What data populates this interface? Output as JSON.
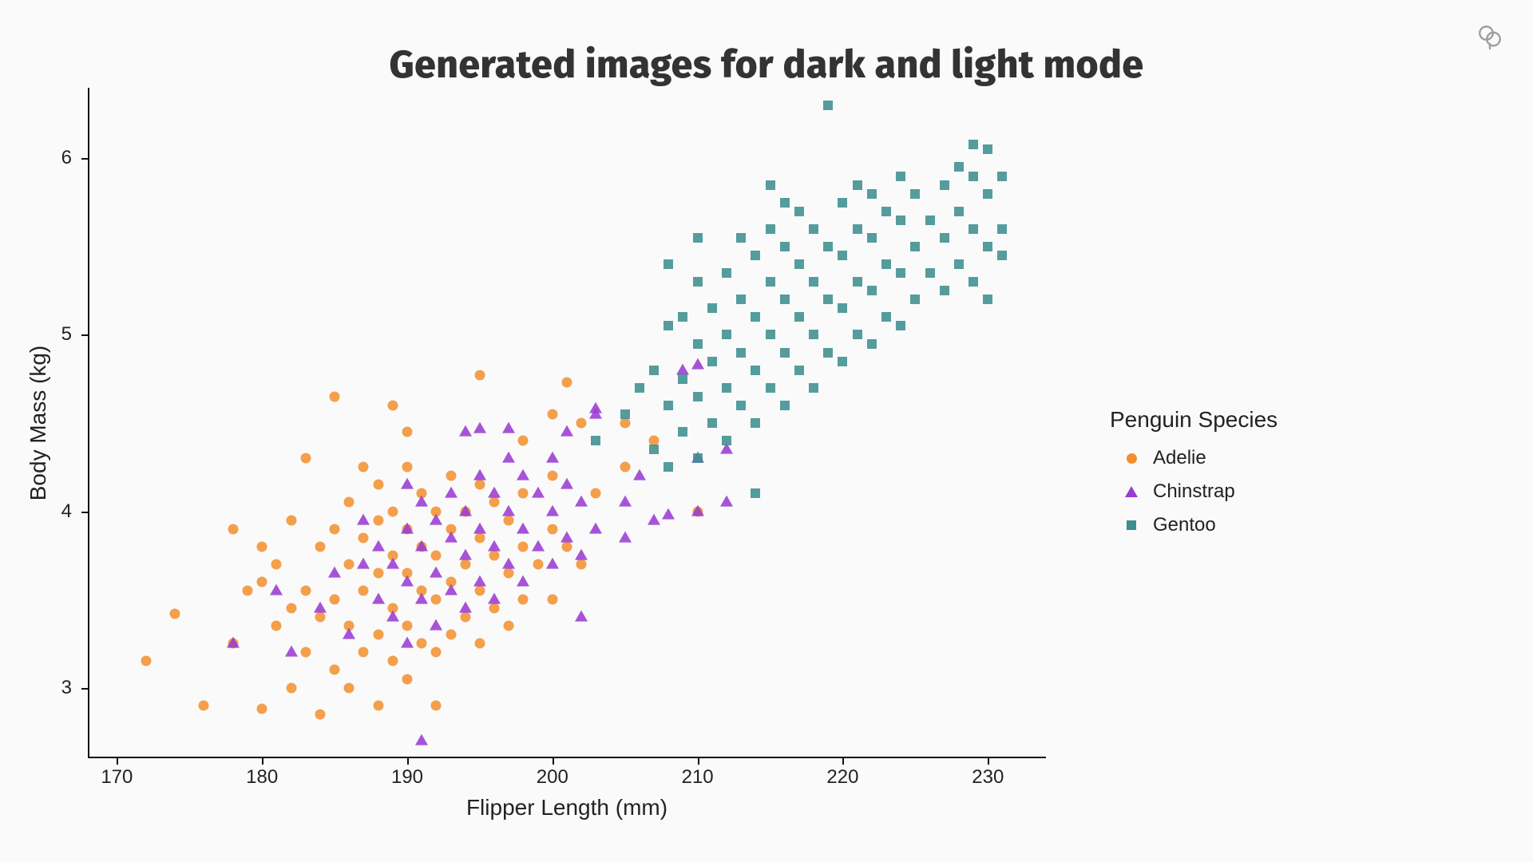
{
  "title": "Generated images for dark and light mode",
  "theme_toggle_name": "theme-toggle",
  "legend": {
    "title": "Penguin Species",
    "items": [
      {
        "label": "Adelie",
        "shape": "circle",
        "color": "#f28e2b"
      },
      {
        "label": "Chinstrap",
        "shape": "triangle",
        "color": "#9b3bd1"
      },
      {
        "label": "Gentoo",
        "shape": "square",
        "color": "#3d8e8e"
      }
    ]
  },
  "chart_data": {
    "type": "scatter",
    "title": "Generated images for dark and light mode",
    "xlabel": "Flipper Length (mm)",
    "ylabel": "Body Mass (kg)",
    "xlim": [
      168,
      234
    ],
    "ylim": [
      2.6,
      6.4
    ],
    "x_ticks": [
      170,
      180,
      190,
      200,
      210,
      220,
      230
    ],
    "y_ticks": [
      3,
      4,
      5,
      6
    ],
    "legend_position": "right",
    "grid": false,
    "series": [
      {
        "name": "Adelie",
        "shape": "circle",
        "color": "#f28e2b",
        "points": [
          [
            172,
            3.15
          ],
          [
            174,
            3.42
          ],
          [
            176,
            2.9
          ],
          [
            178,
            3.25
          ],
          [
            178,
            3.9
          ],
          [
            179,
            3.55
          ],
          [
            180,
            2.88
          ],
          [
            180,
            3.6
          ],
          [
            180,
            3.8
          ],
          [
            181,
            3.35
          ],
          [
            181,
            3.7
          ],
          [
            182,
            3.0
          ],
          [
            182,
            3.45
          ],
          [
            182,
            3.95
          ],
          [
            183,
            3.2
          ],
          [
            183,
            3.55
          ],
          [
            183,
            4.3
          ],
          [
            184,
            3.4
          ],
          [
            184,
            3.8
          ],
          [
            184,
            2.85
          ],
          [
            185,
            3.1
          ],
          [
            185,
            3.5
          ],
          [
            185,
            3.9
          ],
          [
            185,
            4.65
          ],
          [
            186,
            3.0
          ],
          [
            186,
            3.35
          ],
          [
            186,
            3.7
          ],
          [
            186,
            4.05
          ],
          [
            187,
            3.2
          ],
          [
            187,
            3.55
          ],
          [
            187,
            3.85
          ],
          [
            187,
            4.25
          ],
          [
            188,
            2.9
          ],
          [
            188,
            3.3
          ],
          [
            188,
            3.65
          ],
          [
            188,
            3.95
          ],
          [
            188,
            4.15
          ],
          [
            189,
            3.15
          ],
          [
            189,
            3.45
          ],
          [
            189,
            3.75
          ],
          [
            189,
            4.0
          ],
          [
            189,
            4.6
          ],
          [
            190,
            3.05
          ],
          [
            190,
            3.35
          ],
          [
            190,
            3.65
          ],
          [
            190,
            3.9
          ],
          [
            190,
            4.25
          ],
          [
            190,
            4.45
          ],
          [
            191,
            3.25
          ],
          [
            191,
            3.55
          ],
          [
            191,
            3.8
          ],
          [
            191,
            4.1
          ],
          [
            192,
            2.9
          ],
          [
            192,
            3.2
          ],
          [
            192,
            3.5
          ],
          [
            192,
            3.75
          ],
          [
            192,
            4.0
          ],
          [
            193,
            3.3
          ],
          [
            193,
            3.6
          ],
          [
            193,
            3.9
          ],
          [
            193,
            4.2
          ],
          [
            194,
            3.4
          ],
          [
            194,
            3.7
          ],
          [
            194,
            4.0
          ],
          [
            195,
            3.25
          ],
          [
            195,
            3.55
          ],
          [
            195,
            3.85
          ],
          [
            195,
            4.15
          ],
          [
            195,
            4.77
          ],
          [
            196,
            3.45
          ],
          [
            196,
            3.75
          ],
          [
            196,
            4.05
          ],
          [
            197,
            3.35
          ],
          [
            197,
            3.65
          ],
          [
            197,
            3.95
          ],
          [
            198,
            3.5
          ],
          [
            198,
            3.8
          ],
          [
            198,
            4.1
          ],
          [
            198,
            4.4
          ],
          [
            199,
            3.7
          ],
          [
            200,
            3.5
          ],
          [
            200,
            3.9
          ],
          [
            200,
            4.2
          ],
          [
            200,
            4.55
          ],
          [
            201,
            3.8
          ],
          [
            201,
            4.73
          ],
          [
            202,
            3.7
          ],
          [
            202,
            4.5
          ],
          [
            203,
            4.1
          ],
          [
            205,
            4.25
          ],
          [
            205,
            4.5
          ],
          [
            207,
            4.4
          ],
          [
            210,
            4.0
          ]
        ]
      },
      {
        "name": "Chinstrap",
        "shape": "triangle",
        "color": "#9b3bd1",
        "points": [
          [
            178,
            3.25
          ],
          [
            181,
            3.55
          ],
          [
            182,
            3.2
          ],
          [
            184,
            3.45
          ],
          [
            185,
            3.65
          ],
          [
            186,
            3.3
          ],
          [
            187,
            3.7
          ],
          [
            187,
            3.95
          ],
          [
            188,
            3.5
          ],
          [
            188,
            3.8
          ],
          [
            189,
            3.4
          ],
          [
            189,
            3.7
          ],
          [
            190,
            3.25
          ],
          [
            190,
            3.6
          ],
          [
            190,
            3.9
          ],
          [
            190,
            4.15
          ],
          [
            191,
            3.5
          ],
          [
            191,
            3.8
          ],
          [
            191,
            4.05
          ],
          [
            191,
            2.7
          ],
          [
            192,
            3.35
          ],
          [
            192,
            3.65
          ],
          [
            192,
            3.95
          ],
          [
            193,
            3.55
          ],
          [
            193,
            3.85
          ],
          [
            193,
            4.1
          ],
          [
            194,
            3.45
          ],
          [
            194,
            3.75
          ],
          [
            194,
            4.0
          ],
          [
            194,
            4.45
          ],
          [
            195,
            3.6
          ],
          [
            195,
            3.9
          ],
          [
            195,
            4.2
          ],
          [
            195,
            4.47
          ],
          [
            196,
            3.5
          ],
          [
            196,
            3.8
          ],
          [
            196,
            4.1
          ],
          [
            197,
            3.7
          ],
          [
            197,
            4.0
          ],
          [
            197,
            4.3
          ],
          [
            197,
            4.47
          ],
          [
            198,
            3.6
          ],
          [
            198,
            3.9
          ],
          [
            198,
            4.2
          ],
          [
            199,
            3.8
          ],
          [
            199,
            4.1
          ],
          [
            200,
            3.7
          ],
          [
            200,
            4.0
          ],
          [
            200,
            4.3
          ],
          [
            201,
            3.85
          ],
          [
            201,
            4.15
          ],
          [
            201,
            4.45
          ],
          [
            202,
            3.4
          ],
          [
            202,
            3.75
          ],
          [
            202,
            4.05
          ],
          [
            203,
            3.9
          ],
          [
            203,
            4.55
          ],
          [
            203,
            4.58
          ],
          [
            205,
            3.85
          ],
          [
            205,
            4.05
          ],
          [
            206,
            4.2
          ],
          [
            207,
            3.95
          ],
          [
            208,
            3.98
          ],
          [
            209,
            4.8
          ],
          [
            210,
            4.0
          ],
          [
            210,
            4.3
          ],
          [
            210,
            4.83
          ],
          [
            212,
            4.05
          ],
          [
            212,
            4.35
          ]
        ]
      },
      {
        "name": "Gentoo",
        "shape": "square",
        "color": "#3d8e8e",
        "points": [
          [
            203,
            4.4
          ],
          [
            205,
            4.55
          ],
          [
            206,
            4.7
          ],
          [
            207,
            4.35
          ],
          [
            207,
            4.8
          ],
          [
            208,
            4.25
          ],
          [
            208,
            4.6
          ],
          [
            208,
            5.05
          ],
          [
            208,
            5.4
          ],
          [
            209,
            4.45
          ],
          [
            209,
            4.75
          ],
          [
            209,
            5.1
          ],
          [
            210,
            4.3
          ],
          [
            210,
            4.65
          ],
          [
            210,
            4.95
          ],
          [
            210,
            5.3
          ],
          [
            210,
            5.55
          ],
          [
            211,
            4.5
          ],
          [
            211,
            4.85
          ],
          [
            211,
            5.15
          ],
          [
            212,
            4.4
          ],
          [
            212,
            4.7
          ],
          [
            212,
            5.0
          ],
          [
            212,
            5.35
          ],
          [
            213,
            4.6
          ],
          [
            213,
            4.9
          ],
          [
            213,
            5.2
          ],
          [
            213,
            5.55
          ],
          [
            214,
            4.5
          ],
          [
            214,
            4.8
          ],
          [
            214,
            5.1
          ],
          [
            214,
            5.45
          ],
          [
            214,
            4.1
          ],
          [
            215,
            4.7
          ],
          [
            215,
            5.0
          ],
          [
            215,
            5.3
          ],
          [
            215,
            5.6
          ],
          [
            215,
            5.85
          ],
          [
            216,
            4.6
          ],
          [
            216,
            4.9
          ],
          [
            216,
            5.2
          ],
          [
            216,
            5.5
          ],
          [
            216,
            5.75
          ],
          [
            217,
            4.8
          ],
          [
            217,
            5.1
          ],
          [
            217,
            5.4
          ],
          [
            217,
            5.7
          ],
          [
            218,
            4.7
          ],
          [
            218,
            5.0
          ],
          [
            218,
            5.3
          ],
          [
            218,
            5.6
          ],
          [
            219,
            4.9
          ],
          [
            219,
            5.2
          ],
          [
            219,
            5.5
          ],
          [
            219,
            6.3
          ],
          [
            220,
            4.85
          ],
          [
            220,
            5.15
          ],
          [
            220,
            5.45
          ],
          [
            220,
            5.75
          ],
          [
            221,
            5.0
          ],
          [
            221,
            5.3
          ],
          [
            221,
            5.6
          ],
          [
            221,
            5.85
          ],
          [
            222,
            4.95
          ],
          [
            222,
            5.25
          ],
          [
            222,
            5.55
          ],
          [
            222,
            5.8
          ],
          [
            223,
            5.1
          ],
          [
            223,
            5.4
          ],
          [
            223,
            5.7
          ],
          [
            224,
            5.05
          ],
          [
            224,
            5.35
          ],
          [
            224,
            5.65
          ],
          [
            224,
            5.9
          ],
          [
            225,
            5.2
          ],
          [
            225,
            5.5
          ],
          [
            225,
            5.8
          ],
          [
            226,
            5.35
          ],
          [
            226,
            5.65
          ],
          [
            227,
            5.25
          ],
          [
            227,
            5.55
          ],
          [
            227,
            5.85
          ],
          [
            228,
            5.4
          ],
          [
            228,
            5.7
          ],
          [
            228,
            5.95
          ],
          [
            229,
            5.3
          ],
          [
            229,
            5.6
          ],
          [
            229,
            5.9
          ],
          [
            229,
            6.08
          ],
          [
            230,
            5.2
          ],
          [
            230,
            5.5
          ],
          [
            230,
            5.8
          ],
          [
            230,
            6.05
          ],
          [
            231,
            5.6
          ],
          [
            231,
            5.45
          ],
          [
            231,
            5.9
          ]
        ]
      }
    ]
  }
}
